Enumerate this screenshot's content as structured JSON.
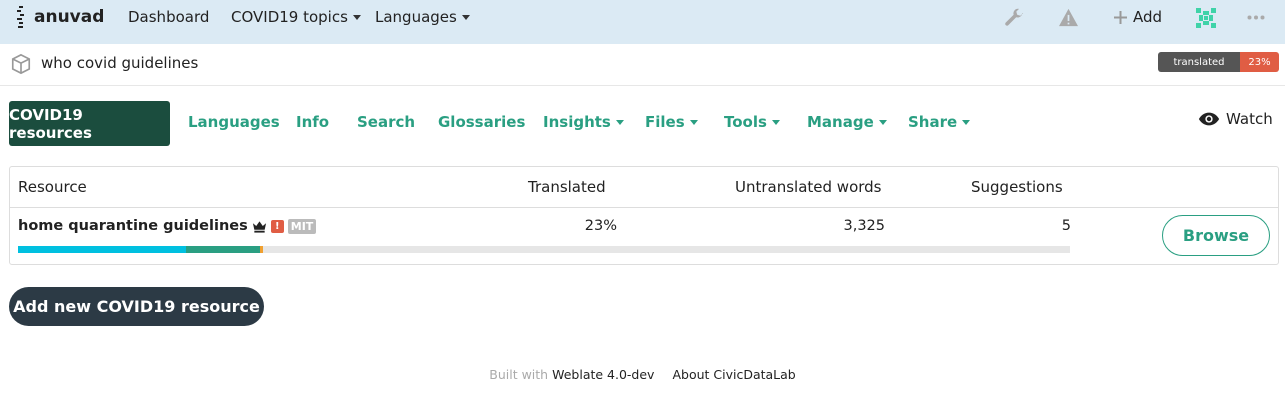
{
  "navbar": {
    "brand": "anuvad",
    "dashboard": "Dashboard",
    "covid_topics": "COVID19 topics",
    "languages": "Languages",
    "add": "Add"
  },
  "breadcrumb": {
    "project": "who covid guidelines",
    "badge_label": "translated",
    "badge_value": "23%"
  },
  "tabs": {
    "active": "COVID19 resources",
    "items": [
      "Languages",
      "Info",
      "Search",
      "Glossaries",
      "Insights",
      "Files",
      "Tools",
      "Manage",
      "Share"
    ],
    "watch": "Watch"
  },
  "table": {
    "headers": [
      "Resource",
      "Translated",
      "Untranslated words",
      "Suggestions"
    ],
    "rows": [
      {
        "name": "home quarantine guidelines",
        "alert": "!",
        "license": "MIT",
        "translated": "23%",
        "untranslated_words": "3,325",
        "suggestions": "5",
        "action": "Browse",
        "progress": {
          "translated_pct": 16,
          "approved_pct": 7,
          "fuzzy_pct": 0.3
        }
      }
    ]
  },
  "actions": {
    "add_resource": "Add new COVID19 resource"
  },
  "footer": {
    "built_with": "Built with",
    "weblate": "Weblate 4.0-dev",
    "about": "About CivicDataLab"
  },
  "colors": {
    "navbar_bg": "#dbeaf4",
    "accent": "#2a9f82",
    "active_tab": "#1b4d3e",
    "badge_red": "#e05d44",
    "progress_cyan": "#00c0e0"
  }
}
